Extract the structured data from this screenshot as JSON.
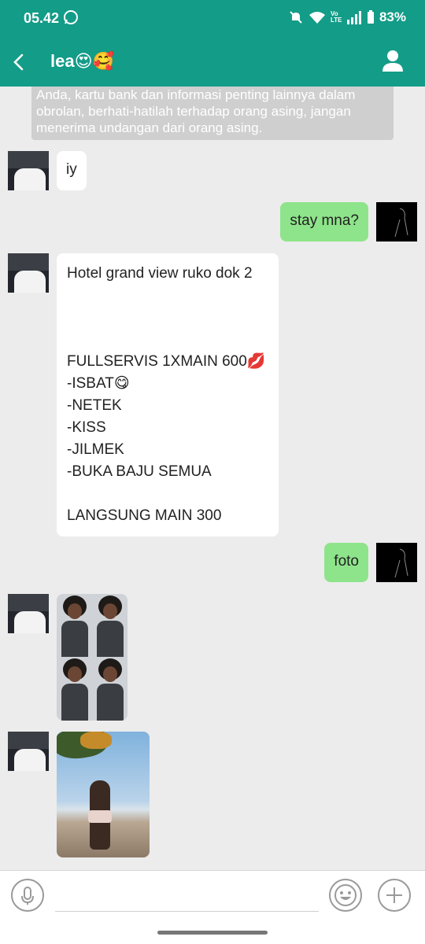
{
  "status_bar": {
    "time": "05.42",
    "battery": "83%",
    "volte": "Vo LTE"
  },
  "header": {
    "title": "lea😍🥰"
  },
  "notice": {
    "text": "Anda, kartu bank dan informasi penting lainnya dalam obrolan, berhati-hatilah terhadap orang asing, jangan menerima undangan dari orang asing."
  },
  "messages": [
    {
      "side": "in",
      "text": "iy"
    },
    {
      "side": "out",
      "text": "stay mna?"
    },
    {
      "side": "in",
      "text": "Hotel grand view ruko dok 2\n\n\n\nFULLSERVIS 1XMAIN 600💋\n-ISBAT😋\n-NETEK\n-KISS\n-JILMEK\n-BUKA BAJU SEMUA\n\nLANGSUNG MAIN 300"
    },
    {
      "side": "out",
      "text": "foto"
    }
  ],
  "input": {
    "placeholder": ""
  },
  "colors": {
    "header": "#139c88",
    "outgoing": "#8ee48a",
    "incoming": "#ffffff",
    "background": "#ececec"
  }
}
